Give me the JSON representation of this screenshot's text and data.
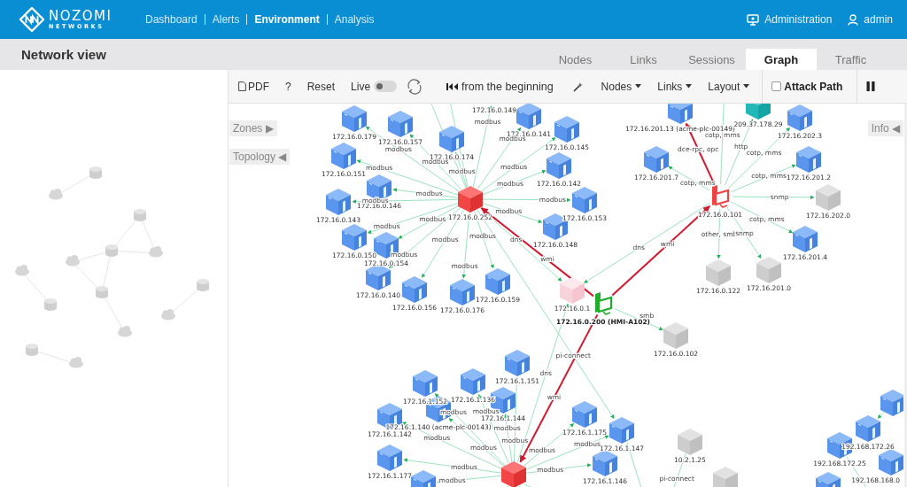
{
  "header": {
    "logo": {
      "name": "NOZOMI",
      "tagline": "NETWORKS"
    },
    "nav": [
      {
        "label": "Dashboard",
        "selected": false
      },
      {
        "label": "Alerts",
        "selected": false
      },
      {
        "label": "Environment",
        "selected": true
      },
      {
        "label": "Analysis",
        "selected": false
      }
    ],
    "admin_link": "Administration",
    "user": "admin"
  },
  "page": {
    "title": "Network view",
    "tabs": [
      {
        "label": "Nodes",
        "selected": false
      },
      {
        "label": "Links",
        "selected": false
      },
      {
        "label": "Sessions",
        "selected": false
      },
      {
        "label": "Graph",
        "selected": true
      },
      {
        "label": "Traffic",
        "selected": false
      }
    ]
  },
  "toolbar": {
    "pdf": "PDF",
    "help": "?",
    "reset": "Reset",
    "live": {
      "label": "Live",
      "on": false
    },
    "replay": "from the beginning",
    "menus": [
      "Nodes",
      "Links",
      "Layout"
    ],
    "attack_path": {
      "label": "Attack Path",
      "checked": false
    }
  },
  "side_tabs": [
    {
      "label": "Zones",
      "arrow": "▶",
      "kind": "left"
    },
    {
      "label": "Topology",
      "arrow": "◀",
      "kind": "left"
    },
    {
      "label": "Info",
      "arrow": "◀",
      "kind": "right"
    }
  ],
  "graph": {
    "nodes": [
      {
        "label": "172.16.0.252",
        "kind": "hub"
      },
      {
        "label": "172.16.0.179",
        "kind": "plc"
      },
      {
        "label": "172.16.0.157",
        "kind": "plc"
      },
      {
        "label": "172.16.0.174",
        "kind": "plc"
      },
      {
        "label": "172.16.0.141",
        "kind": "plc"
      },
      {
        "label": "172.16.0.145",
        "kind": "plc"
      },
      {
        "label": "172.16.0.151",
        "kind": "plc"
      },
      {
        "label": "172.16.0.146",
        "kind": "plc"
      },
      {
        "label": "172.16.0.143",
        "kind": "plc"
      },
      {
        "label": "172.16.0.142",
        "kind": "plc"
      },
      {
        "label": "172.16.0.153",
        "kind": "plc"
      },
      {
        "label": "172.16.0.148",
        "kind": "plc"
      },
      {
        "label": "172.16.0.150",
        "kind": "plc"
      },
      {
        "label": "172.16.0.154",
        "kind": "plc"
      },
      {
        "label": "172.16.0.140",
        "kind": "plc"
      },
      {
        "label": "172.16.0.156",
        "kind": "plc"
      },
      {
        "label": "172.16.0.176",
        "kind": "plc"
      },
      {
        "label": "172.16.0.159",
        "kind": "plc"
      },
      {
        "label": "172.16.0.1",
        "kind": "gateway"
      },
      {
        "label": "172.16.0.200 (HMI-A102)",
        "kind": "hmi"
      },
      {
        "label": "172.16.201.13 (acme-plc-00149)",
        "kind": "plc"
      },
      {
        "label": "172.16.0.101",
        "kind": "workstation"
      },
      {
        "label": "172.16.0.102",
        "kind": "unknown"
      },
      {
        "label": "209.37.178.29",
        "kind": "external"
      },
      {
        "label": "172.16.202.3",
        "kind": "plc"
      },
      {
        "label": "172.16.201.7",
        "kind": "plc"
      },
      {
        "label": "172.16.201.2",
        "kind": "plc"
      },
      {
        "label": "172.16.202.0",
        "kind": "unknown"
      },
      {
        "label": "172.16.201.4",
        "kind": "plc"
      },
      {
        "label": "172.16.0.122",
        "kind": "unknown"
      },
      {
        "label": "172.16.201.0",
        "kind": "unknown"
      },
      {
        "kind": "hub"
      },
      {
        "label": "172.16.1.151",
        "kind": "plc"
      },
      {
        "label": "172.16.1.152",
        "kind": "plc"
      },
      {
        "label": "172.16.1.136",
        "kind": "plc"
      },
      {
        "label": "172.16.1.144",
        "kind": "plc"
      },
      {
        "label": "172.16.1.142",
        "kind": "plc"
      },
      {
        "label": "172.16.1.140 (acme-plc-00143)",
        "kind": "plc"
      },
      {
        "label": "172.16.1.177",
        "kind": "plc"
      },
      {
        "kind": "plc"
      },
      {
        "label": "172.16.1.175",
        "kind": "plc"
      },
      {
        "label": "172.16.1.147",
        "kind": "plc"
      },
      {
        "label": "172.16.1.146",
        "kind": "plc"
      },
      {
        "label": "10.2.1.25",
        "kind": "unknown"
      },
      {
        "kind": "unknown"
      },
      {
        "label": "192.168.172.25",
        "kind": "plc"
      },
      {
        "label": "192.168.172.26",
        "kind": "plc"
      },
      {
        "kind": "plc"
      },
      {
        "label": "192.168.168.0",
        "kind": "plc"
      },
      {
        "kind": "plc"
      },
      {
        "label": "172.16.0.149",
        "kind": "offscreen"
      },
      {
        "kind": "offscreen"
      },
      {
        "kind": "offscreen"
      }
    ],
    "links": [
      {
        "protocol": "modbus",
        "alert": false
      },
      {
        "protocol": "modbus",
        "alert": false
      },
      {
        "protocol": "modbus",
        "alert": false
      },
      {
        "protocol": "modbus",
        "alert": false
      },
      {
        "protocol": "modbus",
        "alert": false
      },
      {
        "protocol": "modbus",
        "alert": false
      },
      {
        "protocol": "modbus",
        "alert": false
      },
      {
        "protocol": "modbus",
        "alert": false
      },
      {
        "protocol": "modbus",
        "alert": false
      },
      {
        "protocol": "modbus",
        "alert": false
      },
      {
        "protocol": "modbus",
        "alert": false
      },
      {
        "protocol": "modbus",
        "alert": false
      },
      {
        "protocol": "modbus",
        "alert": false
      },
      {
        "protocol": "modbus",
        "alert": false
      },
      {
        "protocol": "modbus",
        "alert": false
      },
      {
        "protocol": "modbus",
        "alert": false
      },
      {
        "protocol": "modbus",
        "alert": false
      },
      {
        "protocol": "modbus",
        "alert": false
      },
      {
        "protocol": "dns",
        "alert": false
      },
      {
        "protocol": "wmi",
        "alert": true
      },
      {
        "protocol": "wmi",
        "alert": true
      },
      {
        "protocol": "dns",
        "alert": false
      },
      {
        "protocol": "smb",
        "alert": false
      },
      {
        "protocol": "dce-rpc, opc",
        "alert": true
      },
      {
        "protocol": "http",
        "alert": false
      },
      {
        "protocol": "cotp, mms",
        "alert": false
      },
      {
        "protocol": "cotp, mms",
        "alert": false
      },
      {
        "protocol": "cotp, mms",
        "alert": false
      },
      {
        "protocol": "snmp",
        "alert": false
      },
      {
        "protocol": "cotp, mms",
        "alert": false
      },
      {
        "protocol": "other, smb",
        "alert": false
      },
      {
        "protocol": "snmp",
        "alert": false
      },
      {
        "protocol": "wmi",
        "alert": true
      },
      {
        "protocol": "dns",
        "alert": false
      },
      {
        "protocol": "pi-connect",
        "alert": false
      },
      {
        "protocol": "modbus",
        "alert": false
      },
      {
        "protocol": "modbus",
        "alert": false
      },
      {
        "protocol": "modbus",
        "alert": false
      },
      {
        "protocol": "modbus",
        "alert": false
      },
      {
        "protocol": "modbus",
        "alert": false
      },
      {
        "protocol": "modbus",
        "alert": false
      },
      {
        "protocol": "modbus",
        "alert": false
      },
      {
        "protocol": "modbus",
        "alert": false
      },
      {
        "protocol": "modbus",
        "alert": false
      },
      {
        "protocol": "modbus",
        "alert": false
      },
      {
        "protocol": "modbus",
        "alert": false
      },
      {
        "protocol": "pi-connect",
        "alert": false
      },
      {
        "alert": false
      },
      {
        "protocol": "cotp, mms",
        "alert": false
      }
    ]
  }
}
